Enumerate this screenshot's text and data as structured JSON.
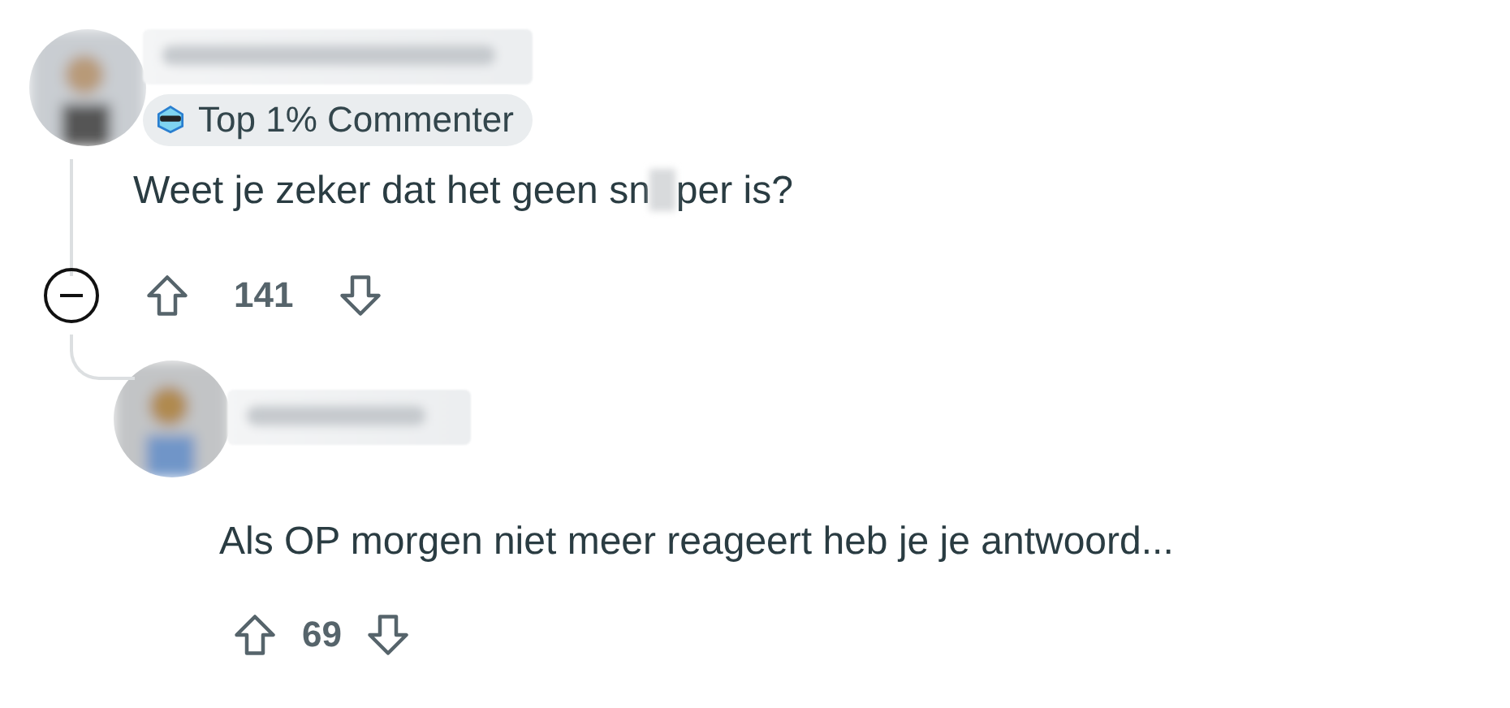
{
  "comments": [
    {
      "badge": "Top 1% Commenter",
      "text_parts": [
        "Weet je zeker dat het geen sn",
        "per is?"
      ],
      "score": "141",
      "collapsible": true
    },
    {
      "text_parts": [
        "Als OP morgen niet meer reageert heb je je antwoord..."
      ],
      "score": "69",
      "collapsible": false
    }
  ]
}
